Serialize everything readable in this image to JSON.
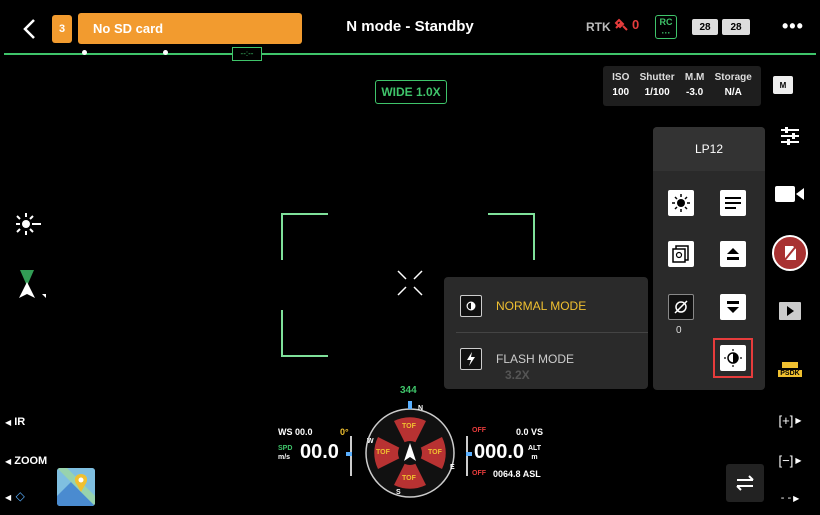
{
  "topbar": {
    "count_badge": "3",
    "sd_message": "No SD card",
    "mode_title": "N mode - Standby",
    "rtk_label": "RTK",
    "satellite_count": "0",
    "rc_label": "RC",
    "battery1": "28",
    "battery2": "28",
    "more": "•••"
  },
  "timeline": {
    "marker": "--:--"
  },
  "camera": {
    "lens_label": "WIDE 1.0X",
    "params": [
      {
        "label": "ISO",
        "value": "100"
      },
      {
        "label": "Shutter",
        "value": "1/100"
      },
      {
        "label": "M.M",
        "value": "-3.0"
      },
      {
        "label": "Storage",
        "value": "N/A"
      }
    ],
    "mode_badge": "M"
  },
  "lp_panel": {
    "title": "LP12",
    "zero_value": "0"
  },
  "mode_popup": {
    "normal_label": "NORMAL MODE",
    "flash_label": "FLASH MODE",
    "ghost_zoom": "3.2X"
  },
  "left": {
    "ir_label": "IR",
    "zoom_label": "ZOOM"
  },
  "right": {
    "psdk_label": "PSDK",
    "zoom_in": "[+]",
    "zoom_out": "[−]",
    "more": "- -"
  },
  "telemetry": {
    "heading": "344",
    "ws_label": "WS 00.0",
    "ws_angle": "0°",
    "spd_unit_top": "SPD",
    "spd_unit_bottom": "m/s",
    "spd_value": "00.0",
    "alt_value": "000.0",
    "alt_unit_top": "ALT",
    "alt_unit_bottom": "m",
    "vs_label": "0.0 VS",
    "asl_label": "0064.8 ASL",
    "off_top": "OFF",
    "off_bottom": "OFF",
    "tof": "TOF",
    "compass_n": "N",
    "compass_e": "E",
    "compass_s": "S",
    "compass_w": "W"
  },
  "colors": {
    "accent_green": "#3fc46a",
    "warning_orange": "#f29b2f",
    "alert_red": "#e63c3c",
    "selected_yellow": "#f0c030"
  }
}
